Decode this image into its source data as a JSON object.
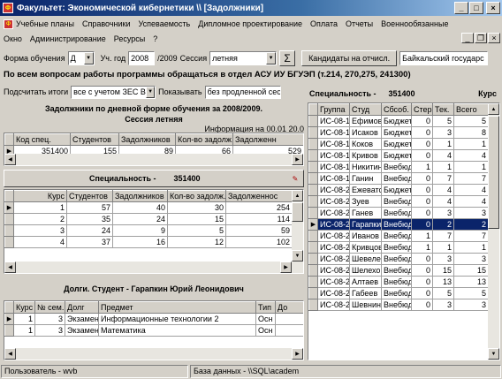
{
  "window": {
    "title": "Факультет: Экономической кибернетики \\\\  [Задолжники]",
    "minimize": "_",
    "maximize": "□",
    "close": "×"
  },
  "menu": {
    "row1": [
      "Учебные планы",
      "Справочники",
      "Успеваемость",
      "Дипломное проектирование",
      "Оплата",
      "Отчеты",
      "Военнообязанные"
    ],
    "row2": [
      "Окно",
      "Администрирование",
      "Ресурсы",
      "?"
    ]
  },
  "toolbar": {
    "form_label": "Форма обучения",
    "form_value": "Д",
    "year_label": "Уч. год",
    "year_value": "2008",
    "year_suffix": "/2009",
    "session_label": "Сессия",
    "session_value": "летняя",
    "sigma": "Σ",
    "candidates_button": "Кандидаты на отчисл.",
    "university_value": "Байкальский государс"
  },
  "notice": "По всем вопросам работы программы обращаться  в отдел АСУ ИУ БГУЭП  (т.214, 270,275, 241300)",
  "filter": {
    "summarize_label": "Подсчитать итоги",
    "summarize_value": "все с учетом ЗЕС ВКЛ",
    "show_label": "Показывать",
    "show_value": "без продленной сессии"
  },
  "summary": {
    "title": "Задолжники по дневной форме обучения за 2008/2009.",
    "subtitle": "Сессия   летняя",
    "info": "Информация на 00.01  20.0",
    "headers": [
      "Код спец.",
      "Студентов",
      "Задолжников",
      "Кол-во задолж.",
      "Задолженн"
    ],
    "rows": [
      [
        "351400",
        "155",
        "89",
        "66",
        "529"
      ]
    ]
  },
  "specialty_section": {
    "label": "Специальность -",
    "value": "351400",
    "headers": [
      "Курс",
      "Студентов",
      "Задолжников",
      "Кол-во задолж.",
      "Задолженнос"
    ],
    "rows": [
      [
        "1",
        "57",
        "40",
        "30",
        "254"
      ],
      [
        "2",
        "35",
        "24",
        "15",
        "114"
      ],
      [
        "3",
        "24",
        "9",
        "5",
        "59"
      ],
      [
        "4",
        "37",
        "16",
        "12",
        "102"
      ]
    ]
  },
  "debts": {
    "title": "Долги. Студент - Гарапкин Юрий Леонидович",
    "headers": [
      "Курс",
      "№ сем.",
      "Долг",
      "Предмет",
      "Тип",
      "До"
    ],
    "rows": [
      [
        "1",
        "3",
        "Экзамен",
        "Информационные технологии 2",
        "Осн",
        ""
      ],
      [
        "1",
        "3",
        "Экзамен",
        "Математика",
        "Осн",
        ""
      ]
    ]
  },
  "right_panel": {
    "label": "Специальность -",
    "value": "351400",
    "course_label": "Курс",
    "headers": [
      "Группа",
      "Студ",
      "Сбсоб.",
      "Стер.",
      "Тек.",
      "Всего"
    ],
    "rows": [
      [
        "ИС-08-1",
        "Ефимов",
        "Бюджет",
        "0",
        "5",
        "5"
      ],
      [
        "ИС-08-1",
        "Исаков",
        "Бюджет",
        "0",
        "3",
        "8"
      ],
      [
        "ИС-08-1",
        "Коков",
        "Бюджет",
        "0",
        "1",
        "1"
      ],
      [
        "ИС-08-1",
        "Кривов",
        "Бюджет",
        "0",
        "4",
        "4"
      ],
      [
        "ИС-08-1",
        "Никитин",
        "Внебюд",
        "1",
        "1",
        "1"
      ],
      [
        "ИС-08-1",
        "Ганин",
        "Внебюд",
        "0",
        "7",
        "7"
      ],
      [
        "ИС-08-2",
        "Ежеватов",
        "Бюджет",
        "0",
        "4",
        "4"
      ],
      [
        "ИС-08-2",
        "Зуев",
        "Внебюд",
        "0",
        "4",
        "4"
      ],
      [
        "ИС-08-2",
        "Ганев",
        "Внебюд",
        "0",
        "3",
        "3"
      ],
      [
        "ИС-08-2",
        "Гарапкин",
        "Внебюд",
        "0",
        "2",
        "2"
      ],
      [
        "ИС-08-2",
        "Иванов",
        "Внебюд",
        "1",
        "7",
        "7"
      ],
      [
        "ИС-08-2",
        "Кривцов",
        "Внебюд",
        "1",
        "1",
        "1"
      ],
      [
        "ИС-08-2",
        "Шевелев",
        "Внебюд",
        "0",
        "3",
        "3"
      ],
      [
        "ИС-08-2",
        "Шелехов",
        "Внебюд",
        "0",
        "15",
        "15"
      ],
      [
        "ИС-08-2",
        "Алтаев",
        "Внебюд",
        "0",
        "13",
        "13"
      ],
      [
        "ИС-08-2",
        "Габеев",
        "Внебюд",
        "0",
        "5",
        "5"
      ],
      [
        "ИС-08-2",
        "Шевнин",
        "Внебюд",
        "0",
        "3",
        "3"
      ]
    ],
    "selected_index": 9
  },
  "status": {
    "user": "Пользователь - wvb",
    "database": "База данных - \\\\SQL\\academ"
  }
}
